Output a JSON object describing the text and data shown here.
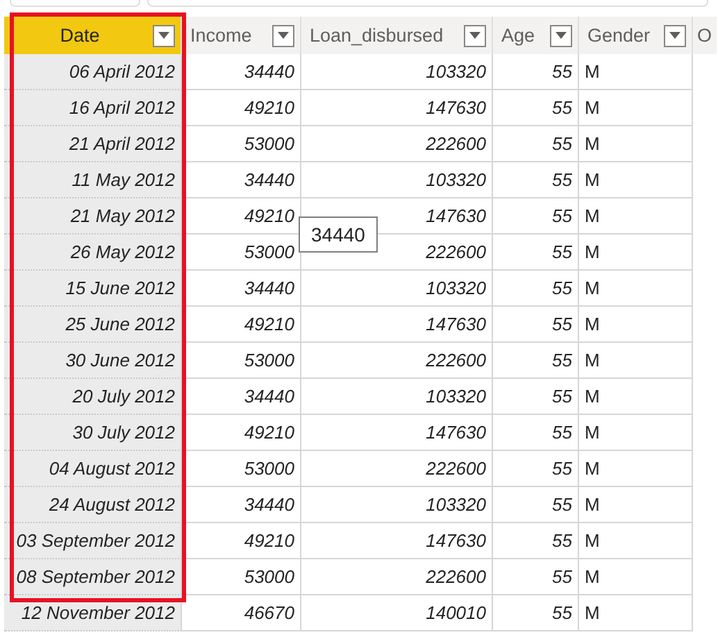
{
  "table": {
    "columns": [
      {
        "label": "Date",
        "selected": true,
        "highlighted": true,
        "kind": "date",
        "filter_button": true
      },
      {
        "label": "Income",
        "selected": false,
        "highlighted": false,
        "kind": "number",
        "filter_button": true
      },
      {
        "label": "Loan_disbursed",
        "selected": false,
        "highlighted": false,
        "kind": "number",
        "filter_button": true
      },
      {
        "label": "Age",
        "selected": false,
        "highlighted": false,
        "kind": "number",
        "filter_button": true
      },
      {
        "label": "Gender",
        "selected": false,
        "highlighted": false,
        "kind": "text",
        "filter_button": true
      },
      {
        "label": "O",
        "selected": false,
        "highlighted": false,
        "kind": "text",
        "filter_button": false
      }
    ],
    "rows": [
      [
        "06 April 2012",
        "34440",
        "103320",
        "55",
        "M"
      ],
      [
        "16 April 2012",
        "49210",
        "147630",
        "55",
        "M"
      ],
      [
        "21 April 2012",
        "53000",
        "222600",
        "55",
        "M"
      ],
      [
        "11 May 2012",
        "34440",
        "103320",
        "55",
        "M"
      ],
      [
        "21 May 2012",
        "49210",
        "147630",
        "55",
        "M"
      ],
      [
        "26 May 2012",
        "53000",
        "222600",
        "55",
        "M"
      ],
      [
        "15 June 2012",
        "34440",
        "103320",
        "55",
        "M"
      ],
      [
        "25 June 2012",
        "49210",
        "147630",
        "55",
        "M"
      ],
      [
        "30 June 2012",
        "53000",
        "222600",
        "55",
        "M"
      ],
      [
        "20 July 2012",
        "34440",
        "103320",
        "55",
        "M"
      ],
      [
        "30 July 2012",
        "49210",
        "147630",
        "55",
        "M"
      ],
      [
        "04 August 2012",
        "53000",
        "222600",
        "55",
        "M"
      ],
      [
        "24 August 2012",
        "34440",
        "103320",
        "55",
        "M"
      ],
      [
        "03 September 2012",
        "49210",
        "147630",
        "55",
        "M"
      ],
      [
        "08 September 2012",
        "53000",
        "222600",
        "55",
        "M"
      ],
      [
        "12 November 2012",
        "46670",
        "140010",
        "55",
        "M"
      ]
    ]
  },
  "tooltip": {
    "text": "34440"
  }
}
